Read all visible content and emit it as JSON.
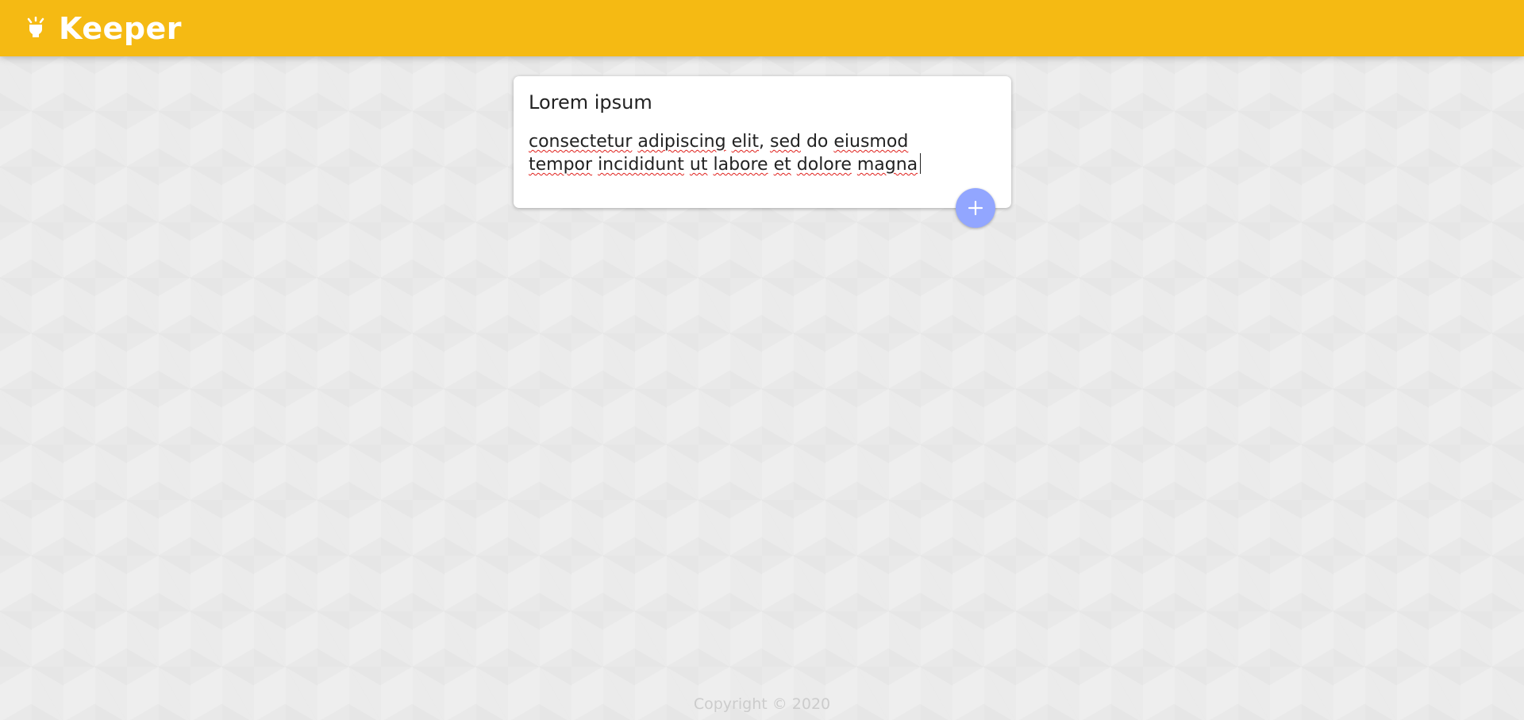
{
  "header": {
    "app_name": "Keeper",
    "logo_icon": "lightbulb-icon",
    "background_color": "#f5ba13"
  },
  "note_form": {
    "title_value": "Lorem ipsum",
    "title_placeholder": "Title",
    "content_lines": [
      [
        {
          "text": "consectetur",
          "misspelled": true
        },
        {
          "text": " ",
          "misspelled": false
        },
        {
          "text": "adipiscing",
          "misspelled": true
        },
        {
          "text": " ",
          "misspelled": false
        },
        {
          "text": "elit",
          "misspelled": true
        },
        {
          "text": ", ",
          "misspelled": false
        },
        {
          "text": "sed",
          "misspelled": true
        },
        {
          "text": " do ",
          "misspelled": false
        },
        {
          "text": "eiusmod",
          "misspelled": true
        }
      ],
      [
        {
          "text": "tempor",
          "misspelled": true
        },
        {
          "text": " ",
          "misspelled": false
        },
        {
          "text": "incididunt",
          "misspelled": true
        },
        {
          "text": " ",
          "misspelled": false
        },
        {
          "text": "ut",
          "misspelled": true
        },
        {
          "text": " ",
          "misspelled": false
        },
        {
          "text": "labore",
          "misspelled": true
        },
        {
          "text": " ",
          "misspelled": false
        },
        {
          "text": "et",
          "misspelled": true
        },
        {
          "text": " ",
          "misspelled": false
        },
        {
          "text": "dolore",
          "misspelled": true
        },
        {
          "text": " ",
          "misspelled": false
        },
        {
          "text": "magna",
          "misspelled": true
        }
      ]
    ],
    "add_button_icon": "plus-icon",
    "add_button_color": "#92a6ff"
  },
  "footer": {
    "copyright": "Copyright © 2020"
  }
}
